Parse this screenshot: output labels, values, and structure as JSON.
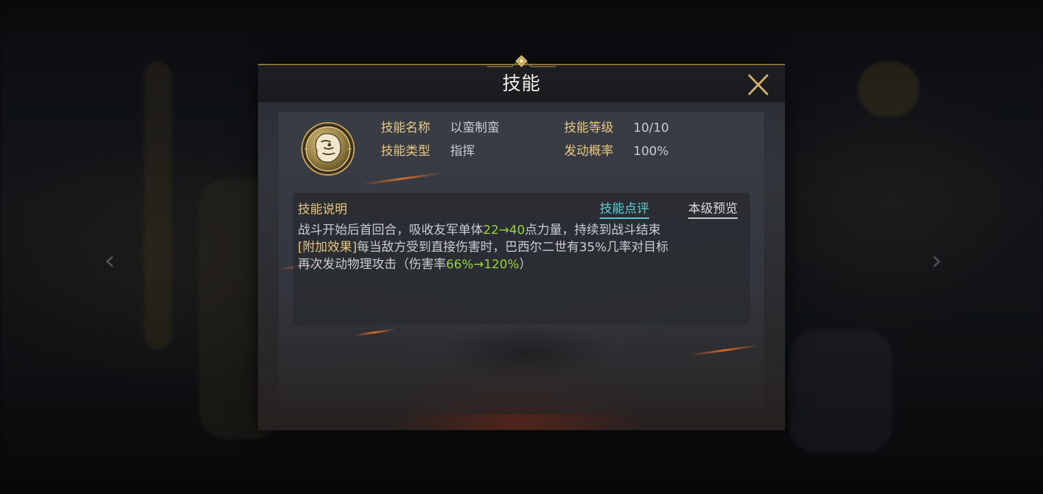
{
  "dialog": {
    "title": "技能",
    "close_icon": "close-icon"
  },
  "skill": {
    "icon": "beast-head-emblem-icon",
    "name_label": "技能名称",
    "name_value": "以蛮制蛮",
    "level_label": "技能等级",
    "level_value": "10/10",
    "type_label": "技能类型",
    "type_value": "指挥",
    "rate_label": "发动概率",
    "rate_value": "100%"
  },
  "description": {
    "title": "技能说明",
    "review_link": "技能点评",
    "preview_link": "本级预览",
    "line1_a": "战斗开始后首回合，吸收友军单体",
    "line1_hl": "22→40",
    "line1_b": "点力量，持续到战斗结束",
    "line2_tag": "[附加效果]",
    "line2_a": "每当敌方受到直接伤害时，巴西尔二世有35%几率对目标",
    "line3_a": "再次发动物理攻击（伤害率",
    "line3_hl": "66%→120%",
    "line3_b": "）"
  },
  "colors": {
    "label_gold": "#e8c783",
    "value_gray": "#c9ccd2",
    "highlight_green": "#9bd13a",
    "link_cyan": "#59d2d8"
  }
}
